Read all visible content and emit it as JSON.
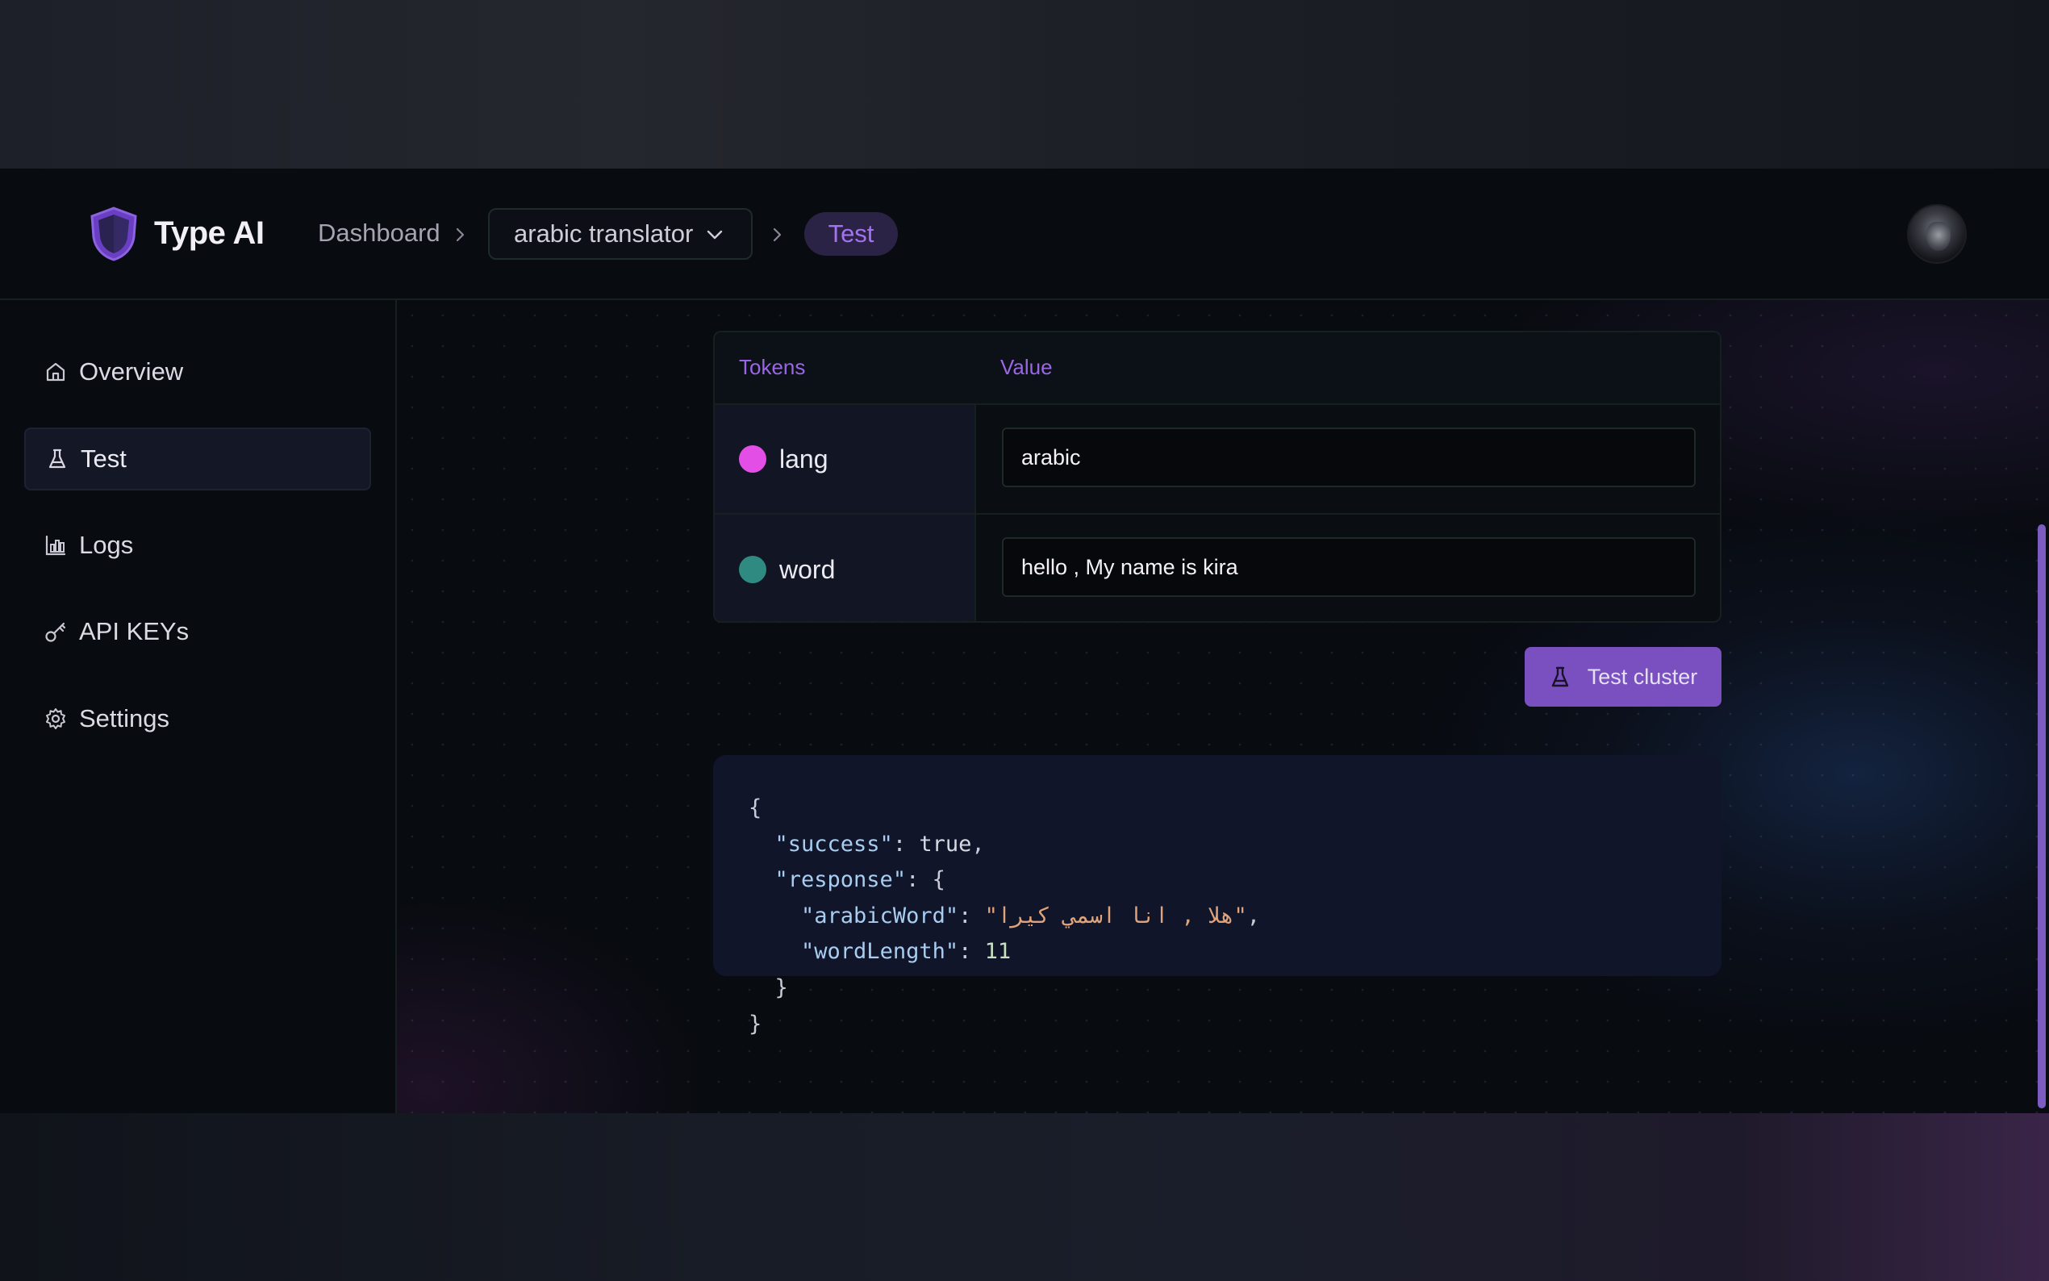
{
  "header": {
    "brand": "Type AI",
    "breadcrumb": {
      "dashboard": "Dashboard",
      "project": "arabic translator",
      "current": "Test"
    }
  },
  "sidebar": {
    "items": [
      {
        "label": "Overview",
        "icon": "home-icon"
      },
      {
        "label": "Test",
        "icon": "flask-icon",
        "active": true
      },
      {
        "label": "Logs",
        "icon": "bar-chart-icon"
      },
      {
        "label": "API KEYs",
        "icon": "key-icon"
      },
      {
        "label": "Settings",
        "icon": "gear-icon"
      }
    ]
  },
  "tokens": {
    "headers": {
      "tokens": "Tokens",
      "value": "Value"
    },
    "rows": [
      {
        "name": "lang",
        "value": "arabic",
        "color": "#e34fe6"
      },
      {
        "name": "word",
        "value": "hello , My name is kira",
        "color": "#2f8a82"
      }
    ]
  },
  "actions": {
    "test_label": "Test cluster"
  },
  "response": {
    "key_success": "\"success\"",
    "val_success": "true",
    "key_response": "\"response\"",
    "key_arabic": "\"arabicWord\"",
    "val_arabic": "\"هلا , انا اسمي كيرا\"",
    "key_length": "\"wordLength\"",
    "val_length": "11"
  },
  "colors": {
    "accent": "#7a4fc0",
    "accent_text": "#a472ef",
    "background": "#080b10"
  }
}
